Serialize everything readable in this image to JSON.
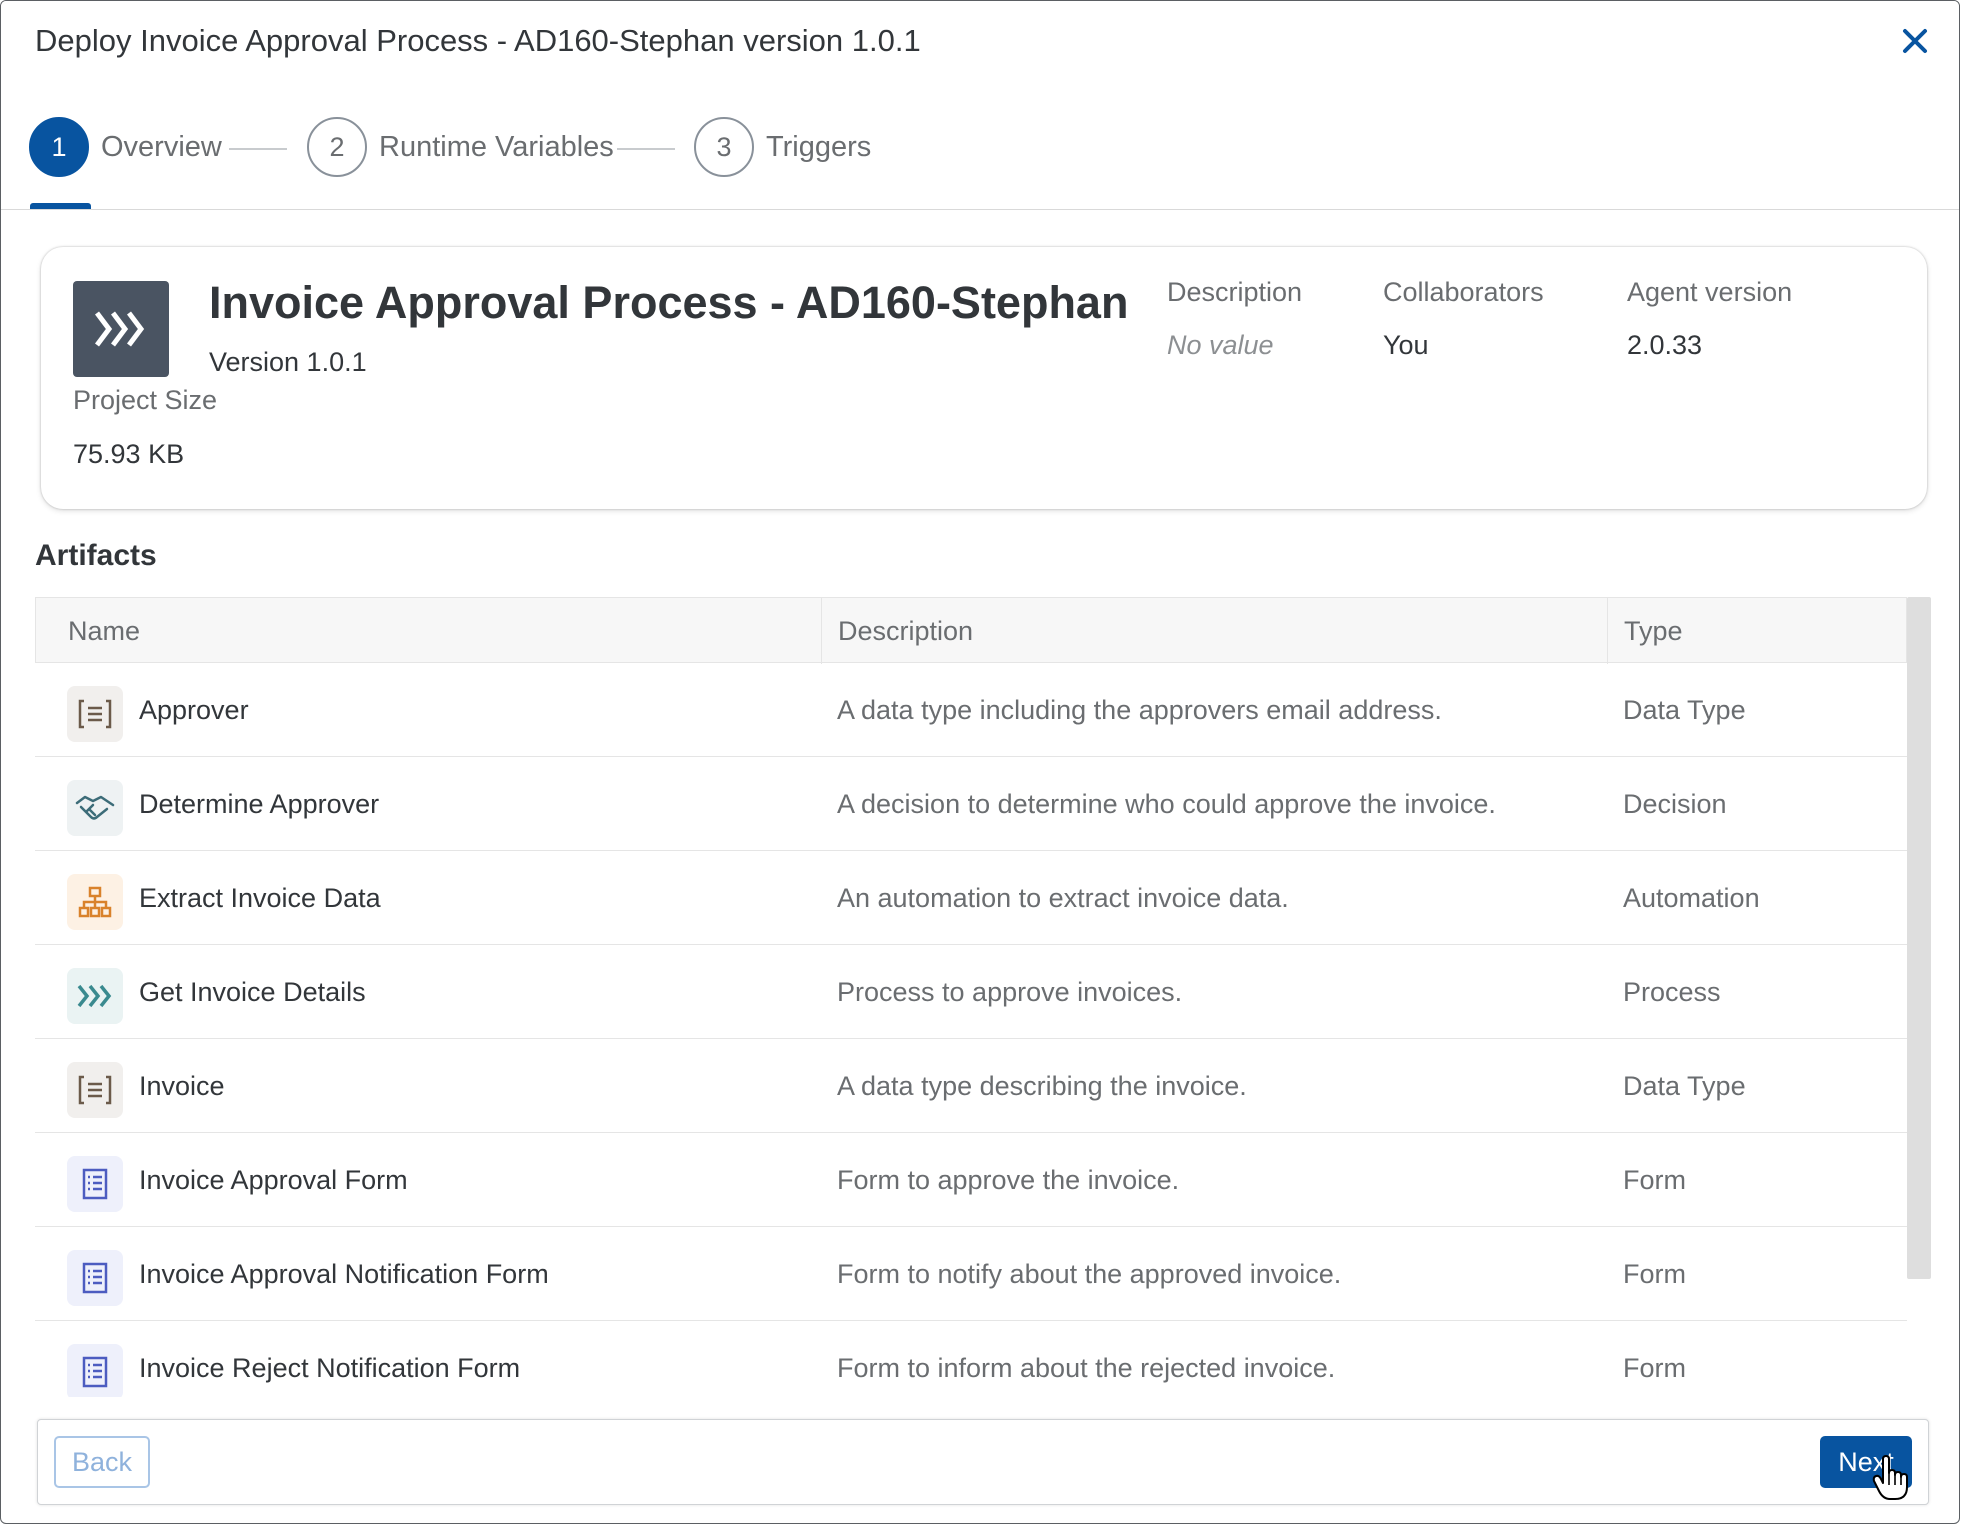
{
  "dialog": {
    "title": "Deploy Invoice Approval Process - AD160-Stephan version 1.0.1",
    "close_icon": "close-icon"
  },
  "stepper": {
    "steps": [
      {
        "number": "1",
        "label": "Overview",
        "active": true
      },
      {
        "number": "2",
        "label": "Runtime Variables",
        "active": false
      },
      {
        "number": "3",
        "label": "Triggers",
        "active": false
      }
    ]
  },
  "project": {
    "icon": "process-chevrons-icon",
    "title": "Invoice Approval Process - AD160-Stephan",
    "version": "Version 1.0.1",
    "size_label": "Project Size",
    "size_value": "75.93 KB",
    "meta": [
      {
        "key": "Description",
        "value": "No value",
        "empty": true
      },
      {
        "key": "Collaborators",
        "value": "You",
        "empty": false
      },
      {
        "key": "Agent version",
        "value": "2.0.33",
        "empty": false
      }
    ]
  },
  "artifacts": {
    "title": "Artifacts",
    "columns": [
      "Name",
      "Description",
      "Type"
    ],
    "rows": [
      {
        "name": "Approver",
        "description": "A data type including the approvers email address.",
        "type": "Data Type",
        "icon": "data-type-icon"
      },
      {
        "name": "Determine Approver",
        "description": "A decision to determine who could approve the invoice.",
        "type": "Decision",
        "icon": "decision-handshake-icon"
      },
      {
        "name": "Extract Invoice Data",
        "description": "An automation to extract invoice data.",
        "type": "Automation",
        "icon": "automation-hierarchy-icon"
      },
      {
        "name": "Get Invoice Details",
        "description": "Process to approve invoices.",
        "type": "Process",
        "icon": "process-chevrons-icon"
      },
      {
        "name": "Invoice",
        "description": "A data type describing the invoice.",
        "type": "Data Type",
        "icon": "data-type-icon"
      },
      {
        "name": "Invoice Approval Form",
        "description": "Form to approve the invoice.",
        "type": "Form",
        "icon": "form-icon"
      },
      {
        "name": "Invoice Approval Notification Form",
        "description": "Form to notify about the approved invoice.",
        "type": "Form",
        "icon": "form-icon"
      },
      {
        "name": "Invoice Reject Notification Form",
        "description": "Form to inform about the rejected invoice.",
        "type": "Form",
        "icon": "form-icon"
      }
    ]
  },
  "footer": {
    "back_label": "Back",
    "next_label": "Next"
  },
  "colors": {
    "accent": "#0854a0",
    "data_type": "#6b5a4a",
    "decision": "#3c6c78",
    "automation": "#d9822b",
    "process": "#3a8a8f",
    "form": "#4c5cc0"
  }
}
